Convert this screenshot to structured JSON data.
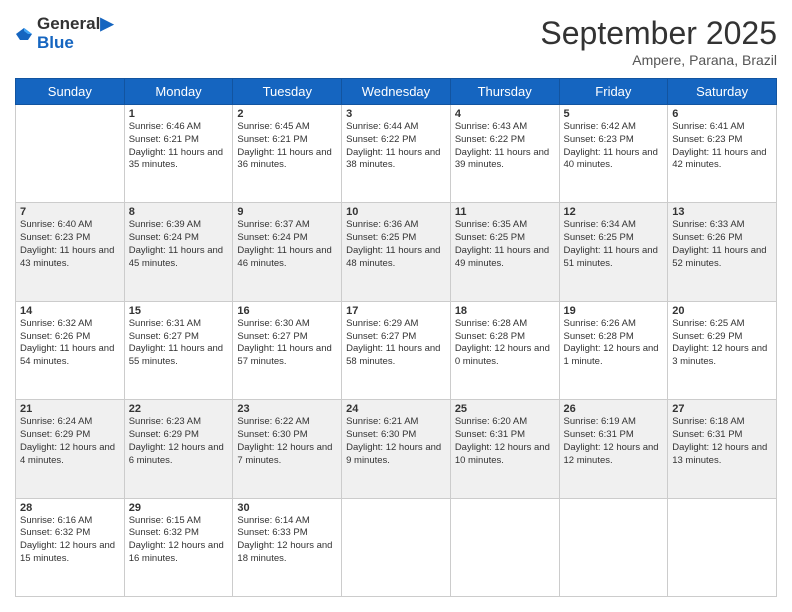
{
  "logo": {
    "line1": "General",
    "line2": "Blue"
  },
  "title": "September 2025",
  "subtitle": "Ampere, Parana, Brazil",
  "headers": [
    "Sunday",
    "Monday",
    "Tuesday",
    "Wednesday",
    "Thursday",
    "Friday",
    "Saturday"
  ],
  "rows": [
    [
      {
        "day": "",
        "sunrise": "",
        "sunset": "",
        "daylight": ""
      },
      {
        "day": "1",
        "sunrise": "Sunrise: 6:46 AM",
        "sunset": "Sunset: 6:21 PM",
        "daylight": "Daylight: 11 hours and 35 minutes."
      },
      {
        "day": "2",
        "sunrise": "Sunrise: 6:45 AM",
        "sunset": "Sunset: 6:21 PM",
        "daylight": "Daylight: 11 hours and 36 minutes."
      },
      {
        "day": "3",
        "sunrise": "Sunrise: 6:44 AM",
        "sunset": "Sunset: 6:22 PM",
        "daylight": "Daylight: 11 hours and 38 minutes."
      },
      {
        "day": "4",
        "sunrise": "Sunrise: 6:43 AM",
        "sunset": "Sunset: 6:22 PM",
        "daylight": "Daylight: 11 hours and 39 minutes."
      },
      {
        "day": "5",
        "sunrise": "Sunrise: 6:42 AM",
        "sunset": "Sunset: 6:23 PM",
        "daylight": "Daylight: 11 hours and 40 minutes."
      },
      {
        "day": "6",
        "sunrise": "Sunrise: 6:41 AM",
        "sunset": "Sunset: 6:23 PM",
        "daylight": "Daylight: 11 hours and 42 minutes."
      }
    ],
    [
      {
        "day": "7",
        "sunrise": "Sunrise: 6:40 AM",
        "sunset": "Sunset: 6:23 PM",
        "daylight": "Daylight: 11 hours and 43 minutes."
      },
      {
        "day": "8",
        "sunrise": "Sunrise: 6:39 AM",
        "sunset": "Sunset: 6:24 PM",
        "daylight": "Daylight: 11 hours and 45 minutes."
      },
      {
        "day": "9",
        "sunrise": "Sunrise: 6:37 AM",
        "sunset": "Sunset: 6:24 PM",
        "daylight": "Daylight: 11 hours and 46 minutes."
      },
      {
        "day": "10",
        "sunrise": "Sunrise: 6:36 AM",
        "sunset": "Sunset: 6:25 PM",
        "daylight": "Daylight: 11 hours and 48 minutes."
      },
      {
        "day": "11",
        "sunrise": "Sunrise: 6:35 AM",
        "sunset": "Sunset: 6:25 PM",
        "daylight": "Daylight: 11 hours and 49 minutes."
      },
      {
        "day": "12",
        "sunrise": "Sunrise: 6:34 AM",
        "sunset": "Sunset: 6:25 PM",
        "daylight": "Daylight: 11 hours and 51 minutes."
      },
      {
        "day": "13",
        "sunrise": "Sunrise: 6:33 AM",
        "sunset": "Sunset: 6:26 PM",
        "daylight": "Daylight: 11 hours and 52 minutes."
      }
    ],
    [
      {
        "day": "14",
        "sunrise": "Sunrise: 6:32 AM",
        "sunset": "Sunset: 6:26 PM",
        "daylight": "Daylight: 11 hours and 54 minutes."
      },
      {
        "day": "15",
        "sunrise": "Sunrise: 6:31 AM",
        "sunset": "Sunset: 6:27 PM",
        "daylight": "Daylight: 11 hours and 55 minutes."
      },
      {
        "day": "16",
        "sunrise": "Sunrise: 6:30 AM",
        "sunset": "Sunset: 6:27 PM",
        "daylight": "Daylight: 11 hours and 57 minutes."
      },
      {
        "day": "17",
        "sunrise": "Sunrise: 6:29 AM",
        "sunset": "Sunset: 6:27 PM",
        "daylight": "Daylight: 11 hours and 58 minutes."
      },
      {
        "day": "18",
        "sunrise": "Sunrise: 6:28 AM",
        "sunset": "Sunset: 6:28 PM",
        "daylight": "Daylight: 12 hours and 0 minutes."
      },
      {
        "day": "19",
        "sunrise": "Sunrise: 6:26 AM",
        "sunset": "Sunset: 6:28 PM",
        "daylight": "Daylight: 12 hours and 1 minute."
      },
      {
        "day": "20",
        "sunrise": "Sunrise: 6:25 AM",
        "sunset": "Sunset: 6:29 PM",
        "daylight": "Daylight: 12 hours and 3 minutes."
      }
    ],
    [
      {
        "day": "21",
        "sunrise": "Sunrise: 6:24 AM",
        "sunset": "Sunset: 6:29 PM",
        "daylight": "Daylight: 12 hours and 4 minutes."
      },
      {
        "day": "22",
        "sunrise": "Sunrise: 6:23 AM",
        "sunset": "Sunset: 6:29 PM",
        "daylight": "Daylight: 12 hours and 6 minutes."
      },
      {
        "day": "23",
        "sunrise": "Sunrise: 6:22 AM",
        "sunset": "Sunset: 6:30 PM",
        "daylight": "Daylight: 12 hours and 7 minutes."
      },
      {
        "day": "24",
        "sunrise": "Sunrise: 6:21 AM",
        "sunset": "Sunset: 6:30 PM",
        "daylight": "Daylight: 12 hours and 9 minutes."
      },
      {
        "day": "25",
        "sunrise": "Sunrise: 6:20 AM",
        "sunset": "Sunset: 6:31 PM",
        "daylight": "Daylight: 12 hours and 10 minutes."
      },
      {
        "day": "26",
        "sunrise": "Sunrise: 6:19 AM",
        "sunset": "Sunset: 6:31 PM",
        "daylight": "Daylight: 12 hours and 12 minutes."
      },
      {
        "day": "27",
        "sunrise": "Sunrise: 6:18 AM",
        "sunset": "Sunset: 6:31 PM",
        "daylight": "Daylight: 12 hours and 13 minutes."
      }
    ],
    [
      {
        "day": "28",
        "sunrise": "Sunrise: 6:16 AM",
        "sunset": "Sunset: 6:32 PM",
        "daylight": "Daylight: 12 hours and 15 minutes."
      },
      {
        "day": "29",
        "sunrise": "Sunrise: 6:15 AM",
        "sunset": "Sunset: 6:32 PM",
        "daylight": "Daylight: 12 hours and 16 minutes."
      },
      {
        "day": "30",
        "sunrise": "Sunrise: 6:14 AM",
        "sunset": "Sunset: 6:33 PM",
        "daylight": "Daylight: 12 hours and 18 minutes."
      },
      {
        "day": "",
        "sunrise": "",
        "sunset": "",
        "daylight": ""
      },
      {
        "day": "",
        "sunrise": "",
        "sunset": "",
        "daylight": ""
      },
      {
        "day": "",
        "sunrise": "",
        "sunset": "",
        "daylight": ""
      },
      {
        "day": "",
        "sunrise": "",
        "sunset": "",
        "daylight": ""
      }
    ]
  ]
}
